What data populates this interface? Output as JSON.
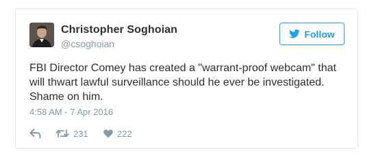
{
  "tweet": {
    "author": {
      "display_name": "Christopher Soghoian",
      "screen_name": "@csoghoian"
    },
    "follow_label": "Follow",
    "text": "FBI Director Comey has created a \"warrant-proof webcam\" that will thwart lawful surveillance should he ever be investigated. Shame on him.",
    "timestamp": "4:58 AM - 7 Apr 2016",
    "actions": {
      "reply_icon": "reply-icon",
      "retweet_icon": "retweet-icon",
      "retweet_count": "231",
      "like_icon": "heart-icon",
      "like_count": "222"
    }
  },
  "colors": {
    "brand_blue": "#1da1f2",
    "text": "#292f33",
    "muted": "#8899a6",
    "border": "#e1e8ed"
  }
}
